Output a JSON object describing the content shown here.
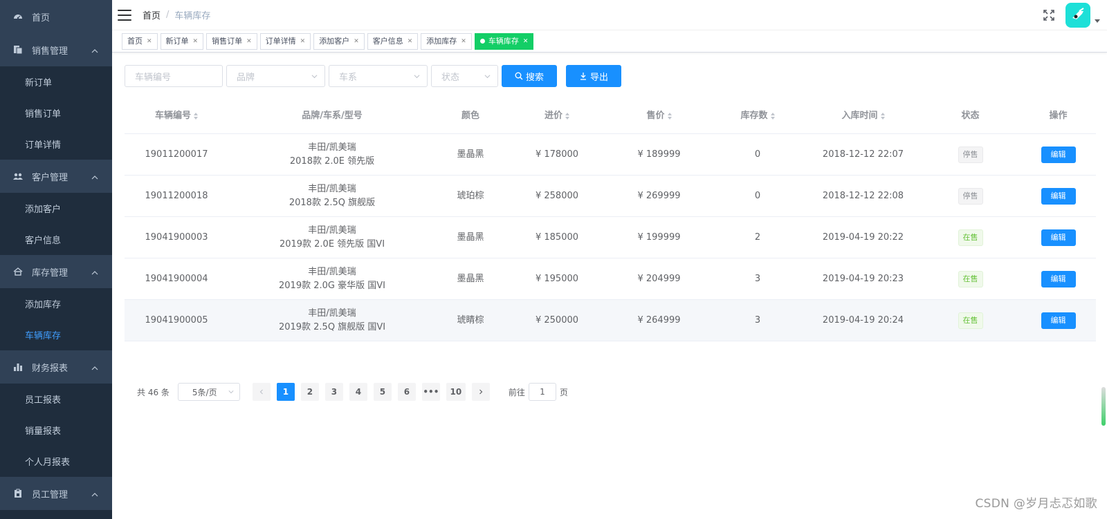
{
  "sidebar": {
    "items": [
      {
        "label": "首页",
        "icon": "dashboard-icon"
      },
      {
        "label": "销售管理",
        "icon": "documents-icon",
        "expanded": true,
        "children": [
          "新订单",
          "销售订单",
          "订单详情"
        ]
      },
      {
        "label": "客户管理",
        "icon": "people-icon",
        "expanded": true,
        "children": [
          "添加客户",
          "客户信息"
        ]
      },
      {
        "label": "库存管理",
        "icon": "home-icon",
        "expanded": true,
        "children": [
          "添加库存",
          "车辆库存"
        ]
      },
      {
        "label": "财务报表",
        "icon": "bar-chart-icon",
        "expanded": true,
        "children": [
          "员工报表",
          "销量报表",
          "个人月报表"
        ]
      },
      {
        "label": "员工管理",
        "icon": "clipboard-icon",
        "expanded": true,
        "children": []
      }
    ],
    "active_child": "车辆库存"
  },
  "header": {
    "breadcrumb_home": "首页",
    "breadcrumb_sep": "/",
    "breadcrumb_current": "车辆库存"
  },
  "tags": [
    "首页",
    "新订单",
    "销售订单",
    "订单详情",
    "添加客户",
    "客户信息",
    "添加库存",
    "车辆库存"
  ],
  "active_tag": "车辆库存",
  "filters": {
    "vehicle_no_placeholder": "车辆编号",
    "brand_placeholder": "品牌",
    "series_placeholder": "车系",
    "status_placeholder": "状态",
    "search_label": "搜索",
    "export_label": "导出"
  },
  "table": {
    "headers": [
      "车辆编号",
      "品牌/车系/型号",
      "颜色",
      "进价",
      "售价",
      "库存数",
      "入库时间",
      "状态",
      "操作"
    ],
    "rows": [
      {
        "id": "19011200017",
        "brand": "丰田/凯美瑞",
        "model": "2018款 2.0E 领先版",
        "color": "墨晶黑",
        "cost": "¥ 178000",
        "price": "¥ 189999",
        "stock": "0",
        "time": "2018-12-12 22:07",
        "status": "停售",
        "on": false
      },
      {
        "id": "19011200018",
        "brand": "丰田/凯美瑞",
        "model": "2018款 2.5Q 旗舰版",
        "color": "琥珀棕",
        "cost": "¥ 258000",
        "price": "¥ 269999",
        "stock": "0",
        "time": "2018-12-12 22:08",
        "status": "停售",
        "on": false
      },
      {
        "id": "19041900003",
        "brand": "丰田/凯美瑞",
        "model": "2019款 2.0E 领先版 国VI",
        "color": "墨晶黑",
        "cost": "¥ 185000",
        "price": "¥ 199999",
        "stock": "2",
        "time": "2019-04-19 20:22",
        "status": "在售",
        "on": true
      },
      {
        "id": "19041900004",
        "brand": "丰田/凯美瑞",
        "model": "2019款 2.0G 豪华版 国VI",
        "color": "墨晶黑",
        "cost": "¥ 195000",
        "price": "¥ 204999",
        "stock": "3",
        "time": "2019-04-19 20:23",
        "status": "在售",
        "on": true
      },
      {
        "id": "19041900005",
        "brand": "丰田/凯美瑞",
        "model": "2019款 2.5Q 旗舰版 国VI",
        "color": "琥睛棕",
        "cost": "¥ 250000",
        "price": "¥ 264999",
        "stock": "3",
        "time": "2019-04-19 20:24",
        "status": "在售",
        "on": true
      }
    ],
    "edit_label": "编辑"
  },
  "pagination": {
    "total_text": "共 46 条",
    "page_size": "5条/页",
    "pages": [
      "1",
      "2",
      "3",
      "4",
      "5",
      "6",
      "•••",
      "10"
    ],
    "current": "1",
    "goto_prefix": "前往",
    "goto_value": "1",
    "goto_suffix": "页"
  },
  "watermark": "CSDN @岁月忐忑如歌",
  "colors": {
    "primary": "#1890ff",
    "sidebar_bg": "#1f2d3d",
    "sidebar_group_bg": "#304156",
    "active_tag": "#13ce66",
    "avatar_bg": "#1de0d8"
  }
}
